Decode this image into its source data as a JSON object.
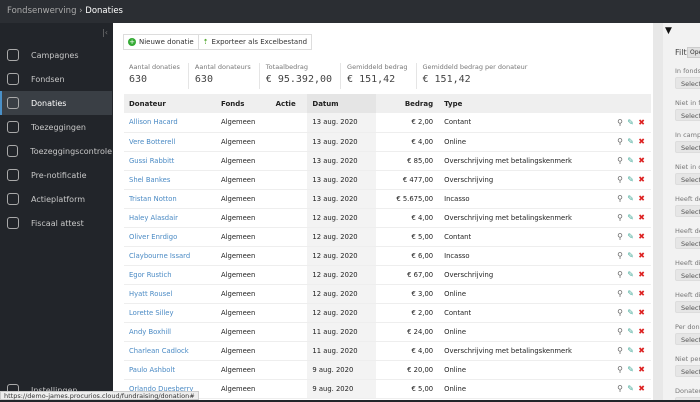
{
  "breadcrumb": {
    "parent": "Fondsenwerving",
    "current": "Donaties"
  },
  "sidebar": {
    "items": [
      {
        "label": "Campagnes",
        "icon": "target-icon"
      },
      {
        "label": "Fondsen",
        "icon": "piggy-bank-icon"
      },
      {
        "label": "Donaties",
        "icon": "donation-icon",
        "active": true
      },
      {
        "label": "Toezeggingen",
        "icon": "hand-icon"
      },
      {
        "label": "Toezeggingscontrole",
        "icon": "hand-check-icon"
      },
      {
        "label": "Pre-notificatie",
        "icon": "bell-icon"
      },
      {
        "label": "Actieplatform",
        "icon": "star-hand-icon"
      },
      {
        "label": "Fiscaal attest",
        "icon": "document-icon"
      }
    ],
    "settings": "Instellingen"
  },
  "toolbar": {
    "new": "Nieuwe donatie",
    "export": "Exporteer als Excelbestand"
  },
  "stats": [
    {
      "label": "Aantal donaties",
      "value": "630"
    },
    {
      "label": "Aantal donateurs",
      "value": "630"
    },
    {
      "label": "Totaalbedrag",
      "value": "€ 95.392,00"
    },
    {
      "label": "Gemiddeld bedrag",
      "value": "€ 151,42"
    },
    {
      "label": "Gemiddeld bedrag per donateur",
      "value": "€ 151,42"
    }
  ],
  "table": {
    "headers": [
      "Donateur",
      "Fonds",
      "Actie",
      "Datum",
      "Bedrag",
      "Type"
    ],
    "rows": [
      [
        "Allison Hacard",
        "Algemeen",
        "",
        "13 aug. 2020",
        "€ 2,00",
        "Contant"
      ],
      [
        "Vere Botterell",
        "Algemeen",
        "",
        "13 aug. 2020",
        "€ 4,00",
        "Online"
      ],
      [
        "Gussi Rabbitt",
        "Algemeen",
        "",
        "13 aug. 2020",
        "€ 85,00",
        "Overschrijving met betalingskenmerk"
      ],
      [
        "Shel Bankes",
        "Algemeen",
        "",
        "13 aug. 2020",
        "€ 477,00",
        "Overschrijving"
      ],
      [
        "Tristan Notton",
        "Algemeen",
        "",
        "13 aug. 2020",
        "€ 5.675,00",
        "Incasso"
      ],
      [
        "Haley Alasdair",
        "Algemeen",
        "",
        "12 aug. 2020",
        "€ 4,00",
        "Overschrijving met betalingskenmerk"
      ],
      [
        "Oliver Enrdigo",
        "Algemeen",
        "",
        "12 aug. 2020",
        "€ 5,00",
        "Contant"
      ],
      [
        "Claybourne Issard",
        "Algemeen",
        "",
        "12 aug. 2020",
        "€ 6,00",
        "Incasso"
      ],
      [
        "Egor Rustich",
        "Algemeen",
        "",
        "12 aug. 2020",
        "€ 67,00",
        "Overschrijving"
      ],
      [
        "Hyatt Rousel",
        "Algemeen",
        "",
        "12 aug. 2020",
        "€ 3,00",
        "Online"
      ],
      [
        "Lorette Silley",
        "Algemeen",
        "",
        "12 aug. 2020",
        "€ 2,00",
        "Contant"
      ],
      [
        "Andy Boxhill",
        "Algemeen",
        "",
        "11 aug. 2020",
        "€ 24,00",
        "Online"
      ],
      [
        "Charlean Cadlock",
        "Algemeen",
        "",
        "11 aug. 2020",
        "€ 4,00",
        "Overschrijving met betalingskenmerk"
      ],
      [
        "Paulo Ashbolt",
        "Algemeen",
        "",
        "9 aug. 2020",
        "€ 20,00",
        "Online"
      ],
      [
        "Orlando Duesberry",
        "Algemeen",
        "",
        "9 aug. 2020",
        "€ 5,00",
        "Online"
      ]
    ]
  },
  "filters": {
    "title": "Filt",
    "open": "Ope",
    "select": "Select",
    "labels": [
      "In fonds",
      "Niet in f",
      "In camp",
      "Niet in c",
      "Heeft de",
      "Heeft de",
      "Heeft di",
      "Heeft di",
      "Per dona",
      "Niet per",
      "Donateu"
    ]
  },
  "status_url": "https://demo-james.procurios.cloud/fundraising/donation#"
}
